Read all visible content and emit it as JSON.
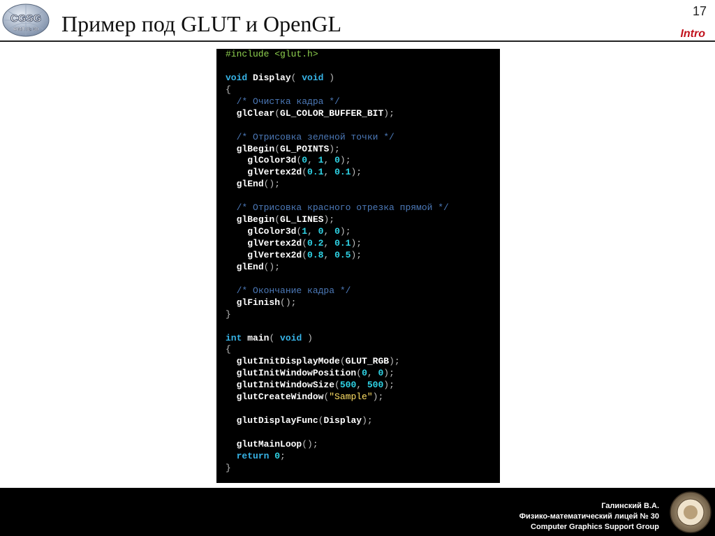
{
  "slide": {
    "title": "Пример под GLUT и OpenGL",
    "page_number": "17",
    "section": "Intro",
    "logo_text": "CGSG",
    "logo_subtext": "ФМЛ № 30"
  },
  "code_lines": [
    [
      [
        "pre",
        "#include <glut.h>"
      ]
    ],
    [],
    [
      [
        "kw",
        "void"
      ],
      [
        "pn",
        " "
      ],
      [
        "fn",
        "Display"
      ],
      [
        "pn",
        "( "
      ],
      [
        "kw",
        "void"
      ],
      [
        "pn",
        " )"
      ]
    ],
    [
      [
        "pn",
        "{"
      ]
    ],
    [
      [
        "pn",
        "  "
      ],
      [
        "cm",
        "/* Очистка кадра */"
      ]
    ],
    [
      [
        "pn",
        "  "
      ],
      [
        "fn",
        "glClear"
      ],
      [
        "pn",
        "("
      ],
      [
        "fn",
        "GL_COLOR_BUFFER_BIT"
      ],
      [
        "pn",
        ");"
      ]
    ],
    [],
    [
      [
        "pn",
        "  "
      ],
      [
        "cm",
        "/* Отрисовка зеленой точки */"
      ]
    ],
    [
      [
        "pn",
        "  "
      ],
      [
        "fn",
        "glBegin"
      ],
      [
        "pn",
        "("
      ],
      [
        "fn",
        "GL_POINTS"
      ],
      [
        "pn",
        ");"
      ]
    ],
    [
      [
        "pn",
        "    "
      ],
      [
        "fn",
        "glColor3d"
      ],
      [
        "pn",
        "("
      ],
      [
        "num",
        "0"
      ],
      [
        "pn",
        ", "
      ],
      [
        "num",
        "1"
      ],
      [
        "pn",
        ", "
      ],
      [
        "num",
        "0"
      ],
      [
        "pn",
        ");"
      ]
    ],
    [
      [
        "pn",
        "    "
      ],
      [
        "fn",
        "glVertex2d"
      ],
      [
        "pn",
        "("
      ],
      [
        "num",
        "0.1"
      ],
      [
        "pn",
        ", "
      ],
      [
        "num",
        "0.1"
      ],
      [
        "pn",
        ");"
      ]
    ],
    [
      [
        "pn",
        "  "
      ],
      [
        "fn",
        "glEnd"
      ],
      [
        "pn",
        "();"
      ]
    ],
    [],
    [
      [
        "pn",
        "  "
      ],
      [
        "cm",
        "/* Отрисовка красного отрезка прямой */"
      ]
    ],
    [
      [
        "pn",
        "  "
      ],
      [
        "fn",
        "glBegin"
      ],
      [
        "pn",
        "("
      ],
      [
        "fn",
        "GL_LINES"
      ],
      [
        "pn",
        ");"
      ]
    ],
    [
      [
        "pn",
        "    "
      ],
      [
        "fn",
        "glColor3d"
      ],
      [
        "pn",
        "("
      ],
      [
        "num",
        "1"
      ],
      [
        "pn",
        ", "
      ],
      [
        "num",
        "0"
      ],
      [
        "pn",
        ", "
      ],
      [
        "num",
        "0"
      ],
      [
        "pn",
        ");"
      ]
    ],
    [
      [
        "pn",
        "    "
      ],
      [
        "fn",
        "glVertex2d"
      ],
      [
        "pn",
        "("
      ],
      [
        "num",
        "0.2"
      ],
      [
        "pn",
        ", "
      ],
      [
        "num",
        "0.1"
      ],
      [
        "pn",
        ");"
      ]
    ],
    [
      [
        "pn",
        "    "
      ],
      [
        "fn",
        "glVertex2d"
      ],
      [
        "pn",
        "("
      ],
      [
        "num",
        "0.8"
      ],
      [
        "pn",
        ", "
      ],
      [
        "num",
        "0.5"
      ],
      [
        "pn",
        ");"
      ]
    ],
    [
      [
        "pn",
        "  "
      ],
      [
        "fn",
        "glEnd"
      ],
      [
        "pn",
        "();"
      ]
    ],
    [],
    [
      [
        "pn",
        "  "
      ],
      [
        "cm",
        "/* Окончание кадра */"
      ]
    ],
    [
      [
        "pn",
        "  "
      ],
      [
        "fn",
        "glFinish"
      ],
      [
        "pn",
        "();"
      ]
    ],
    [
      [
        "pn",
        "}"
      ]
    ],
    [],
    [
      [
        "kw",
        "int"
      ],
      [
        "pn",
        " "
      ],
      [
        "fn",
        "main"
      ],
      [
        "pn",
        "( "
      ],
      [
        "kw",
        "void"
      ],
      [
        "pn",
        " )"
      ]
    ],
    [
      [
        "pn",
        "{"
      ]
    ],
    [
      [
        "pn",
        "  "
      ],
      [
        "fn",
        "glutInitDisplayMode"
      ],
      [
        "pn",
        "("
      ],
      [
        "fn",
        "GLUT_RGB"
      ],
      [
        "pn",
        ");"
      ]
    ],
    [
      [
        "pn",
        "  "
      ],
      [
        "fn",
        "glutInitWindowPosition"
      ],
      [
        "pn",
        "("
      ],
      [
        "num",
        "0"
      ],
      [
        "pn",
        ", "
      ],
      [
        "num",
        "0"
      ],
      [
        "pn",
        ");"
      ]
    ],
    [
      [
        "pn",
        "  "
      ],
      [
        "fn",
        "glutInitWindowSize"
      ],
      [
        "pn",
        "("
      ],
      [
        "num",
        "500"
      ],
      [
        "pn",
        ", "
      ],
      [
        "num",
        "500"
      ],
      [
        "pn",
        ");"
      ]
    ],
    [
      [
        "pn",
        "  "
      ],
      [
        "fn",
        "glutCreateWindow"
      ],
      [
        "pn",
        "("
      ],
      [
        "str",
        "\"Sample\""
      ],
      [
        "pn",
        ");"
      ]
    ],
    [],
    [
      [
        "pn",
        "  "
      ],
      [
        "fn",
        "glutDisplayFunc"
      ],
      [
        "pn",
        "("
      ],
      [
        "fn",
        "Display"
      ],
      [
        "pn",
        ");"
      ]
    ],
    [],
    [
      [
        "pn",
        "  "
      ],
      [
        "fn",
        "glutMainLoop"
      ],
      [
        "pn",
        "();"
      ]
    ],
    [
      [
        "pn",
        "  "
      ],
      [
        "kw",
        "return"
      ],
      [
        "pn",
        " "
      ],
      [
        "num",
        "0"
      ],
      [
        "pn",
        ";"
      ]
    ],
    [
      [
        "pn",
        "}"
      ]
    ]
  ],
  "footer": {
    "author": "Галинский В.А.",
    "school": "Физико-математический лицей № 30",
    "group": "Computer Graphics Support Group"
  },
  "colors": {
    "title": "#111111",
    "section": "#c1121c",
    "code_bg": "#000000",
    "footer_bg": "#000000"
  }
}
